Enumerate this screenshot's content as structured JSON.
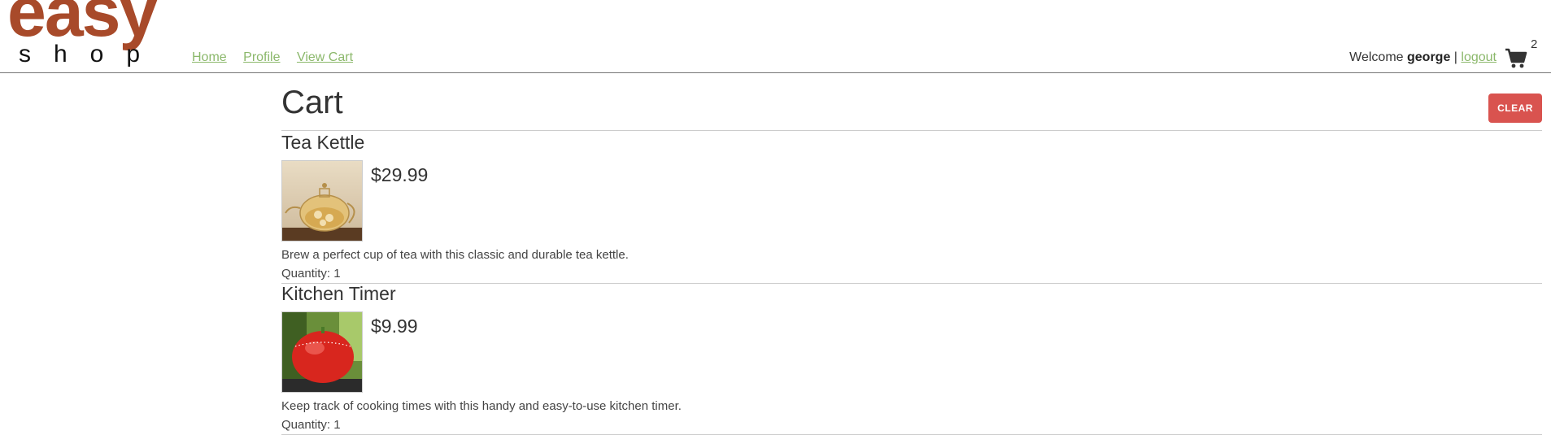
{
  "logo": {
    "top": "easy",
    "bottom": "shop"
  },
  "nav": [
    {
      "label": "Home"
    },
    {
      "label": "Profile"
    },
    {
      "label": "View Cart"
    }
  ],
  "user": {
    "welcome": "Welcome",
    "name": "george",
    "separator": "|",
    "logout": "logout",
    "cart_count": "2"
  },
  "cart": {
    "title": "Cart",
    "clear_label": "CLEAR",
    "quantity_label": "Quantity:",
    "items": [
      {
        "name": "Tea Kettle",
        "price": "$29.99",
        "description": "Brew a perfect cup of tea with this classic and durable tea kettle.",
        "quantity": "Quantity: 1",
        "image": "tea-kettle-photo"
      },
      {
        "name": "Kitchen Timer",
        "price": "$9.99",
        "description": "Keep track of cooking times with this handy and easy-to-use kitchen timer.",
        "quantity": "Quantity: 1",
        "image": "apple-timer-photo"
      }
    ]
  },
  "colors": {
    "brand": "#a84a2a",
    "link": "#8bb86b",
    "danger": "#d9534f"
  }
}
